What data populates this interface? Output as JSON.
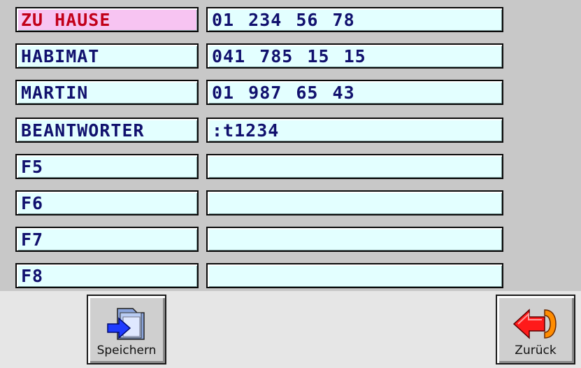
{
  "entries": [
    {
      "name": "ZU HAUSE",
      "number": "01 234 56 78",
      "active": true
    },
    {
      "name": "HABIMAT",
      "number": "041 785 15 15",
      "active": false
    },
    {
      "name": "MARTIN",
      "number": "01 987 65 43",
      "active": false
    },
    {
      "name": "BEANTWORTER",
      "number": ":t1234",
      "active": false
    },
    {
      "name": "F5",
      "number": "",
      "active": false
    },
    {
      "name": "F6",
      "number": "",
      "active": false
    },
    {
      "name": "F7",
      "number": "",
      "active": false
    },
    {
      "name": "F8",
      "number": "",
      "active": false
    }
  ],
  "toolbar": {
    "save_label": "Speichern",
    "save_icon": "folder-arrow-icon",
    "back_label": "Zurück",
    "back_icon": "back-arrow-icon"
  },
  "colors": {
    "cell_bg": "#e3ffff",
    "cell_text": "#11116e",
    "active_bg": "#f7c4f2",
    "active_text": "#c2001a",
    "page_bg": "#c8c8c8",
    "bar_bg": "#e6e6e6"
  }
}
